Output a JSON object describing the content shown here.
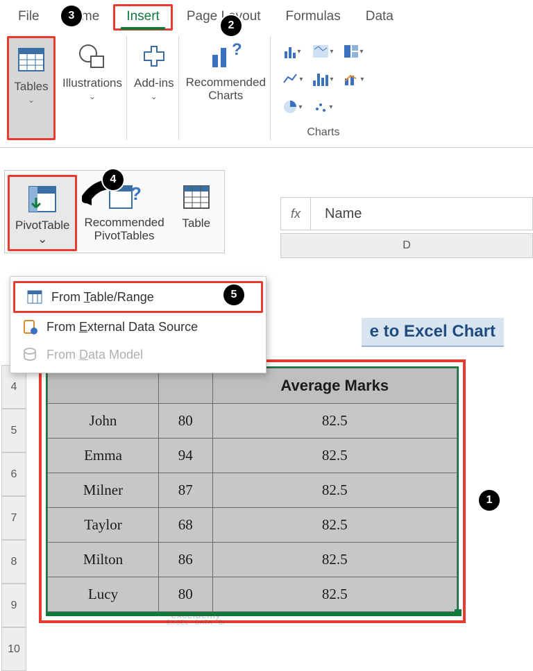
{
  "tabs": {
    "file": "File",
    "home": "Home",
    "insert": "Insert",
    "page_layout": "Page Layout",
    "formulas": "Formulas",
    "data": "Data"
  },
  "ribbon": {
    "tables": "Tables",
    "illustrations": "Illustrations",
    "addins": "Add-ins",
    "recommended_charts": "Recommended Charts",
    "charts_group": "Charts"
  },
  "tables_sub": {
    "pivottable": "PivotTable",
    "recommended": "Recommended PivotTables",
    "table": "Table"
  },
  "pivot_menu": {
    "from_table_range_pre": "From ",
    "from_table_range_u": "T",
    "from_table_range_post": "able/Range",
    "from_external_pre": "From ",
    "from_external_u": "E",
    "from_external_post": "xternal Data Source",
    "from_model_pre": "From ",
    "from_model_u": "D",
    "from_model_post": "ata Model"
  },
  "formula_bar": {
    "fx": "fx",
    "value": "Name"
  },
  "col_header": "D",
  "title_fragment": "e to Excel Chart",
  "row_numbers": [
    "4",
    "5",
    "6",
    "7",
    "8",
    "9",
    "10"
  ],
  "table": {
    "headers": [
      "",
      "",
      "Average Marks"
    ],
    "rows": [
      [
        "John",
        "80",
        "82.5"
      ],
      [
        "Emma",
        "94",
        "82.5"
      ],
      [
        "Milner",
        "87",
        "82.5"
      ],
      [
        "Taylor",
        "68",
        "82.5"
      ],
      [
        "Milton",
        "86",
        "82.5"
      ],
      [
        "Lucy",
        "80",
        "82.5"
      ]
    ]
  },
  "callouts": {
    "c1": "1",
    "c2": "2",
    "c3": "3",
    "c4": "4",
    "c5": "5"
  },
  "watermark": {
    "top": "exceldemy",
    "bottom": "EXCEL · DATA · BI"
  }
}
